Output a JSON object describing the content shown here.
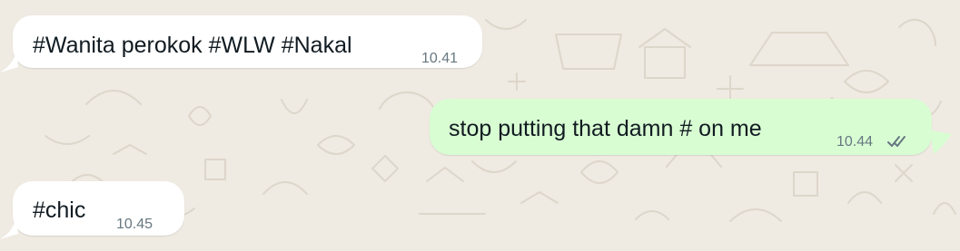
{
  "theme": {
    "chat_background": "#efeae2",
    "incoming_bubble": "#ffffff",
    "outgoing_bubble": "#d9fdd3",
    "text_color": "#111b21",
    "meta_color": "#667781",
    "tick_color": "#667781"
  },
  "messages": [
    {
      "direction": "incoming",
      "text": "#Wanita perokok #WLW #Nakal",
      "time": "10.41"
    },
    {
      "direction": "outgoing",
      "text": "stop putting that damn # on me",
      "time": "10.44",
      "status_icon": "double-check-icon"
    },
    {
      "direction": "incoming",
      "text": "#chic",
      "time": "10.45"
    }
  ]
}
